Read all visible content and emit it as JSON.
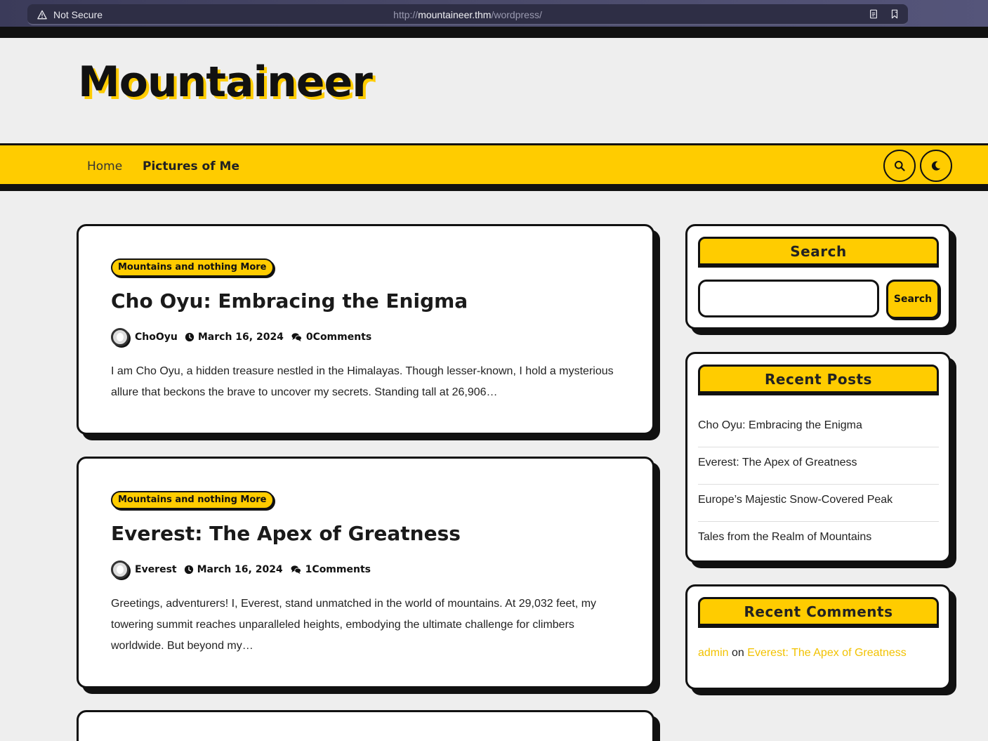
{
  "browser": {
    "security_label": "Not Secure",
    "url_scheme": "http://",
    "url_host": "mountaineer.thm",
    "url_path": "/wordpress/"
  },
  "site": {
    "title": "Mountaineer"
  },
  "nav": {
    "items": [
      {
        "label": "Home"
      },
      {
        "label": "Pictures of Me"
      }
    ]
  },
  "posts": [
    {
      "category": "Mountains and nothing More",
      "title": "Cho Oyu: Embracing the Enigma",
      "author": "ChoOyu",
      "date": "March 16, 2024",
      "comments": "0Comments",
      "excerpt": "I am Cho Oyu, a hidden treasure nestled in the Himalayas. Though lesser-known, I hold a mysterious allure that beckons the brave to uncover my secrets. Standing tall at 26,906…"
    },
    {
      "category": "Mountains and nothing More",
      "title": "Everest: The Apex of Greatness",
      "author": "Everest",
      "date": "March 16, 2024",
      "comments": "1Comments",
      "excerpt": "Greetings, adventurers! I, Everest, stand unmatched in the world of mountains. At 29,032 feet, my towering summit reaches unparalleled heights, embodying the ultimate challenge for climbers worldwide. But beyond my…"
    }
  ],
  "sidebar": {
    "search": {
      "heading": "Search",
      "button_label": "Search",
      "placeholder": ""
    },
    "recent_posts": {
      "heading": "Recent Posts",
      "items": [
        "Cho Oyu: Embracing the Enigma",
        "Everest: The Apex of Greatness",
        "Europe’s Majestic Snow-Covered Peak",
        "Tales from the Realm of Mountains"
      ]
    },
    "recent_comments": {
      "heading": "Recent Comments",
      "author": "admin",
      "connector": "on",
      "post": "Everest: The Apex of Greatness"
    }
  },
  "colors": {
    "accent": "#ffcc00",
    "ink": "#111111",
    "background": "#eeeeee"
  }
}
